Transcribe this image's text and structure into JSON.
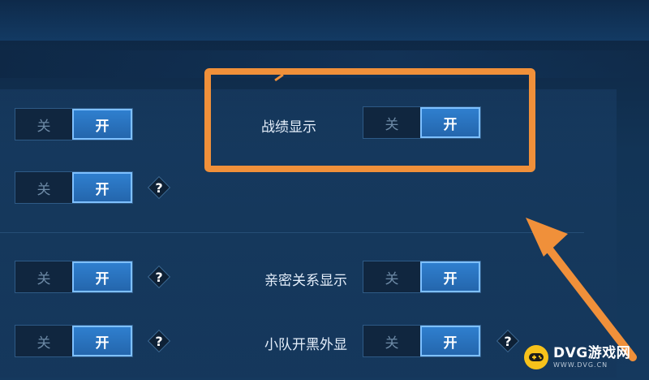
{
  "toggle_text": {
    "off": "关",
    "on": "开"
  },
  "help_text": "?",
  "settings": {
    "left": [
      {
        "state": "on"
      },
      {
        "state": "on",
        "has_help": true
      },
      {
        "state": "on",
        "has_help": true
      },
      {
        "state": "on",
        "has_help": true
      }
    ],
    "right": [
      {
        "label": "战绩显示",
        "state": "on",
        "highlighted": true
      },
      {
        "label": "亲密关系显示",
        "state": "on"
      },
      {
        "label": "小队开黑外显",
        "state": "on",
        "has_help": true
      }
    ]
  },
  "annotation": {
    "color": "#f0903a"
  },
  "watermark": {
    "name": "DVG游戏网",
    "url": "WWW.DVG.CN",
    "badge_color": "#f7c21b"
  },
  "colors": {
    "toggle_on": "#2f7fcf",
    "toggle_off": "#10263f",
    "background": "#123456"
  }
}
